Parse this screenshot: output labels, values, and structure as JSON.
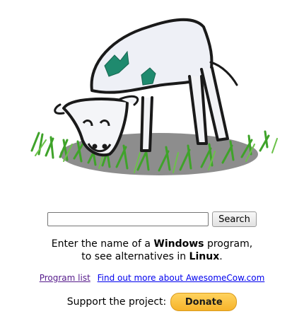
{
  "hero": {
    "image_icon": "grazing-cow-drawing"
  },
  "search": {
    "input_value": "",
    "button_label": "Search"
  },
  "hint": {
    "line1_prefix": "Enter the name of a ",
    "line1_bold": "Windows",
    "line1_suffix": " program,",
    "line2_prefix": "to see alternatives in ",
    "line2_bold": "Linux",
    "line2_suffix": "."
  },
  "links": {
    "program_list": "Program list",
    "find_out_more": "Find out more about AwesomeCow.com"
  },
  "support": {
    "label": "Support the project:",
    "donate_label": "Donate"
  },
  "colors": {
    "visited_link": "#551a8b",
    "link": "#0000ee",
    "donate_bg": "#f6b32a",
    "grass": "#3fa32a",
    "cow_accent": "#1f8a6e"
  }
}
